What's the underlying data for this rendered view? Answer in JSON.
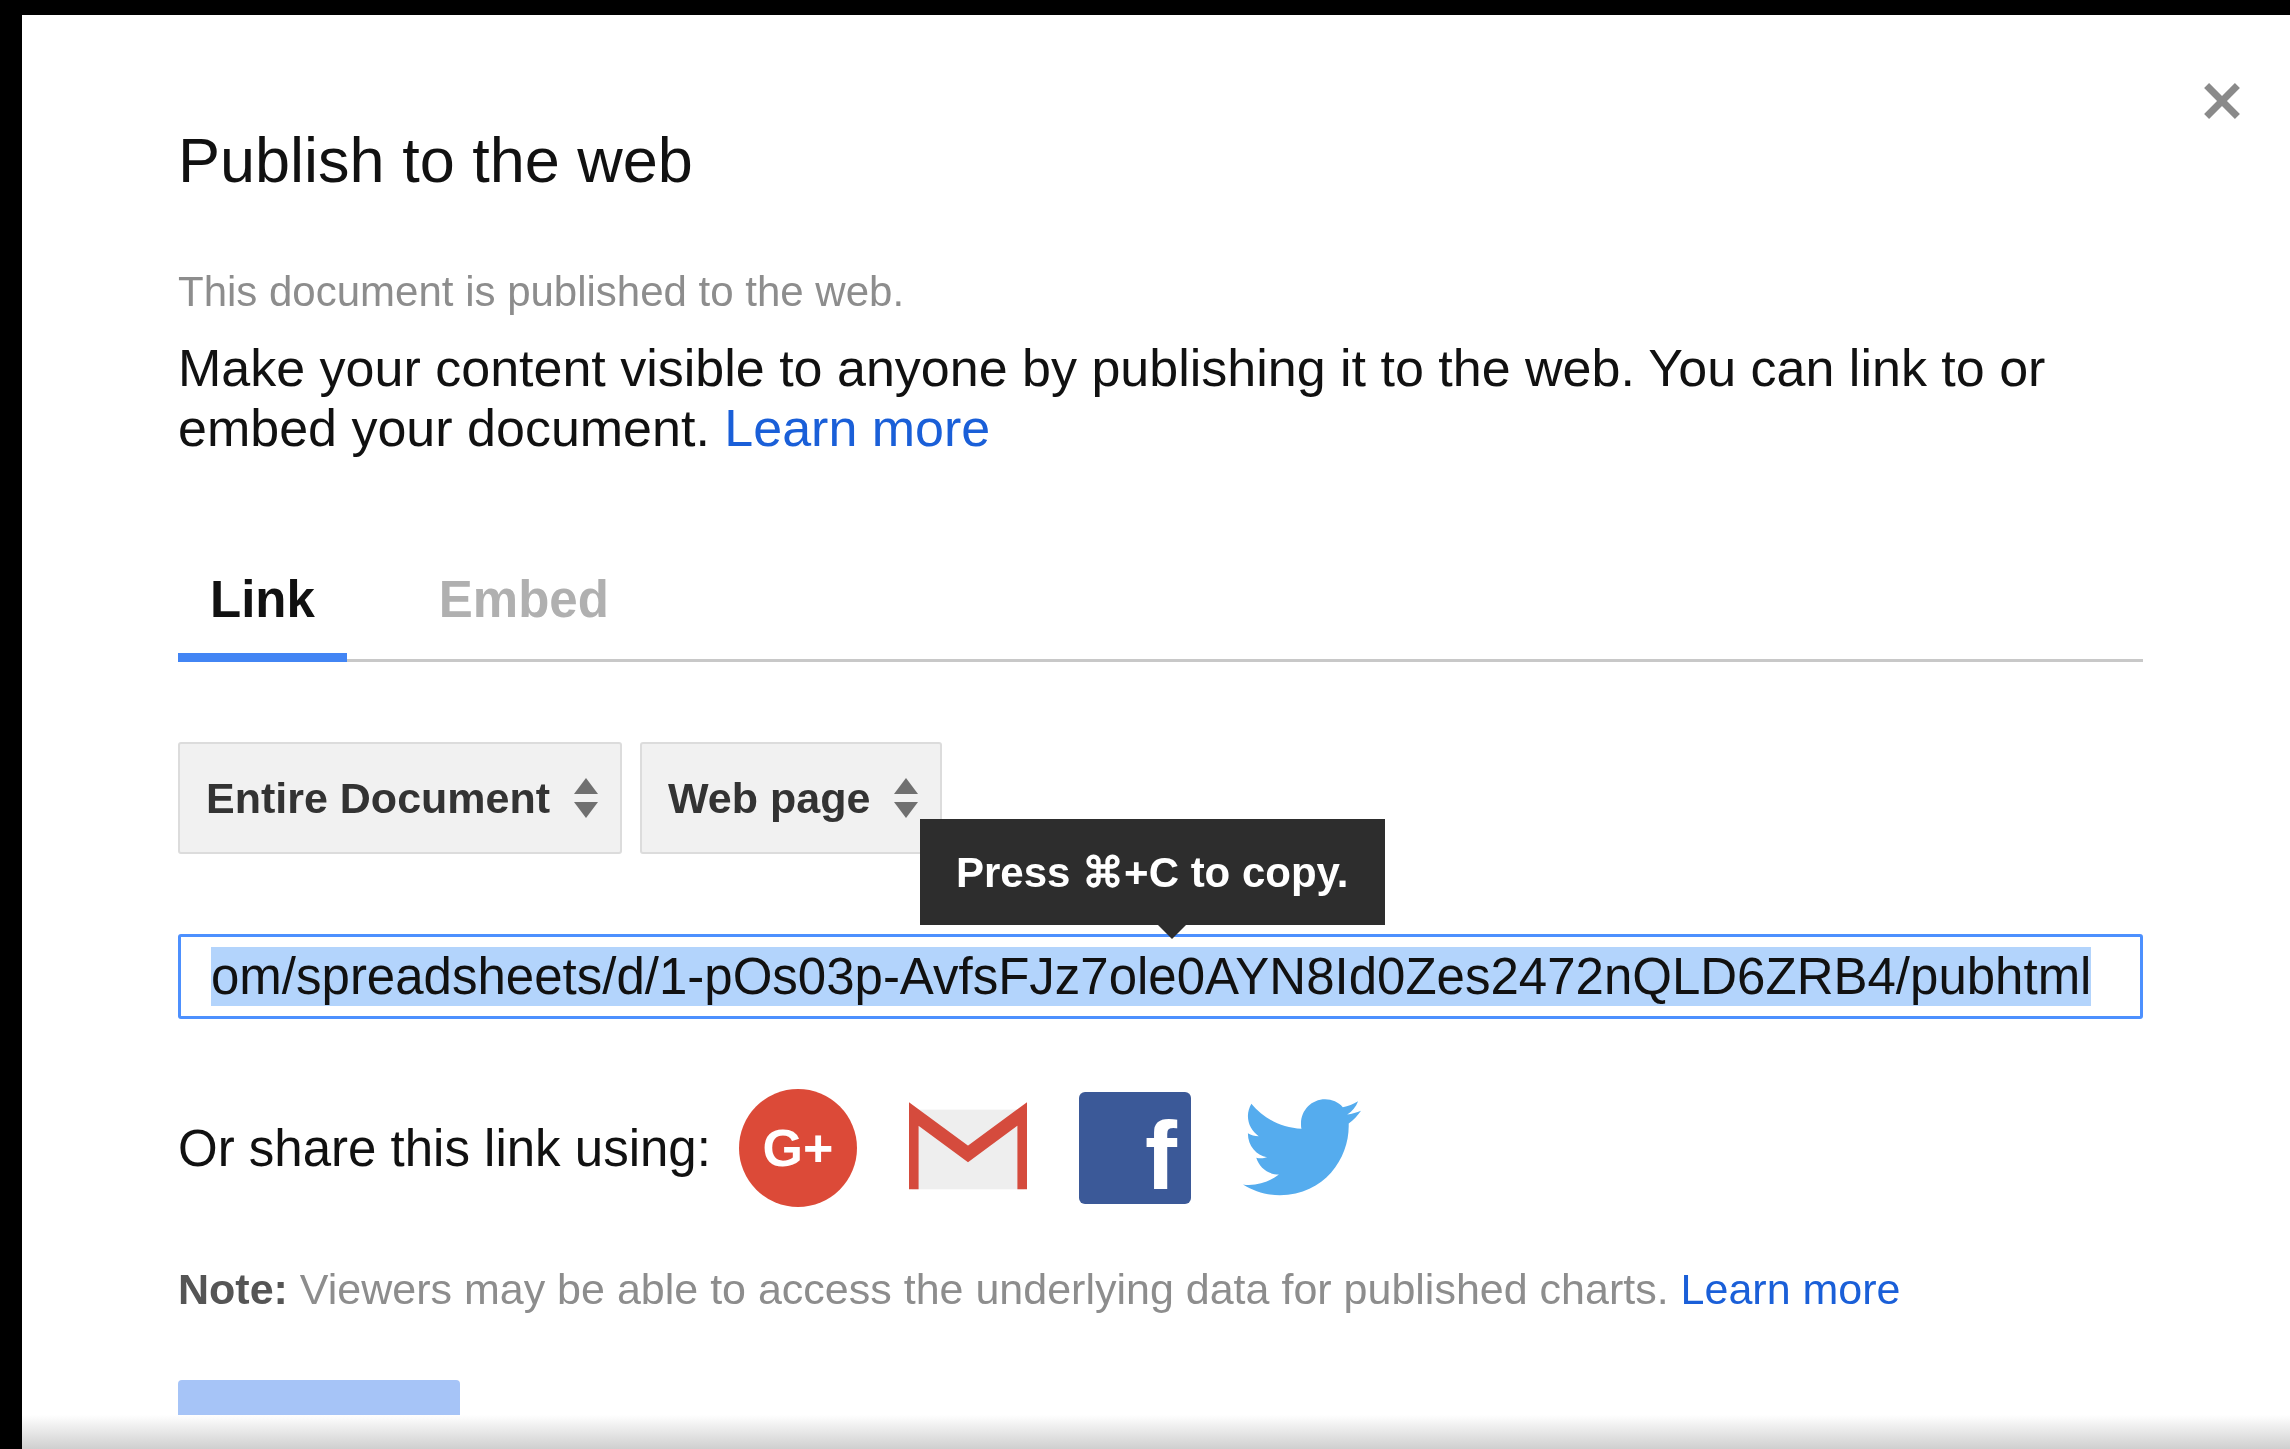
{
  "dialog": {
    "title": "Publish to the web",
    "status": "This document is published to the web.",
    "description": "Make your content visible to anyone by publishing it to the web. You can link to or embed your document.",
    "description_link": "Learn more",
    "tabs": [
      {
        "label": "Link",
        "selected": true
      },
      {
        "label": "Embed",
        "selected": false
      }
    ],
    "dropdowns": [
      {
        "value": "Entire Document"
      },
      {
        "value": "Web page"
      }
    ],
    "tooltip": "Press ⌘+C to copy.",
    "url_field": {
      "value": "om/spreadsheets/d/1-pOs03p-AvfsFJz7ole0AYN8Id0Zes2472nQLD6ZRB4/pubhtml",
      "selected": true
    },
    "share": {
      "label": "Or share this link using:",
      "services": [
        {
          "kind": "googleplus",
          "glyph": "G+"
        },
        {
          "kind": "gmail"
        },
        {
          "kind": "facebook",
          "glyph": "f"
        },
        {
          "kind": "twitter"
        }
      ]
    },
    "note": {
      "text": "**Note:** Viewers may be able to access the underlying data for published charts.",
      "link": "Learn more"
    },
    "publish_button": {
      "disabled": true
    }
  }
}
